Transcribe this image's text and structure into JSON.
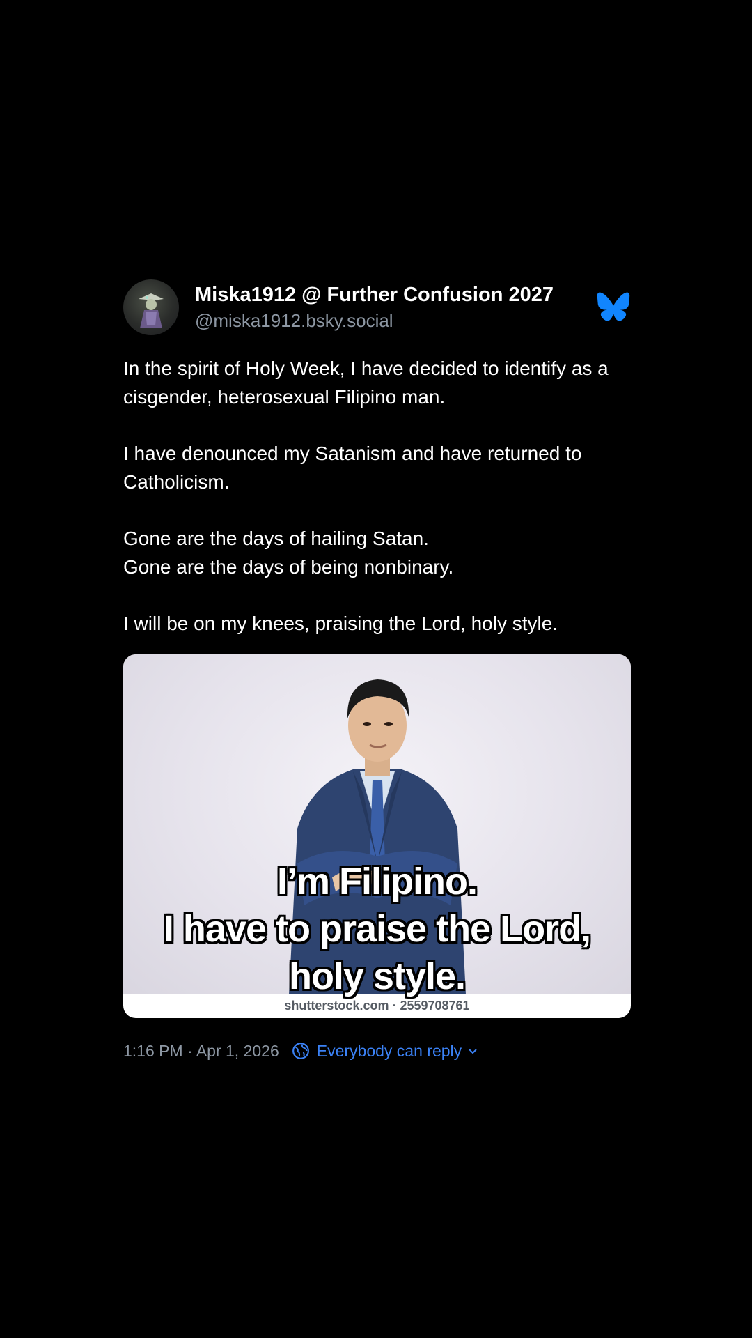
{
  "post": {
    "author": {
      "display_name": "Miska1912 @ Further Confusion 2027",
      "handle": "@miska1912.bsky.social",
      "avatar_icon": "avatar"
    },
    "platform_icon": "bluesky-butterfly-icon",
    "accent_color": "#1185fe",
    "paragraphs": [
      "In the spirit of Holy Week, I have decided to identify as a cisgender, heterosexual Filipino man.",
      "I have denounced my Satanism and have returned to Catholicism.",
      "Gone are the days of hailing Satan.\nGone are the days of being nonbinary.",
      "I will be on my knees, praising the Lord, holy style."
    ],
    "lines": {
      "p1": "In the spirit of Holy Week, I have decided to identify as a cisgender, heterosexual Filipino man.",
      "p2": "I have denounced my Satanism and have returned to Catholicism.",
      "p3a": "Gone are the days of hailing Satan.",
      "p3b": "Gone are the days of being nonbinary.",
      "p4": "I will be on my knees, praising the Lord, holy style."
    },
    "media": {
      "caption_lines": [
        "I’m Filipino.",
        "I have to praise the Lord,",
        "holy style."
      ],
      "watermark": "shutterstock.com · 2559708761"
    },
    "footer": {
      "timestamp": "1:16 PM · Apr 1, 2026",
      "reply_setting": "Everybody can reply",
      "reply_color": "#3b82f6"
    }
  }
}
